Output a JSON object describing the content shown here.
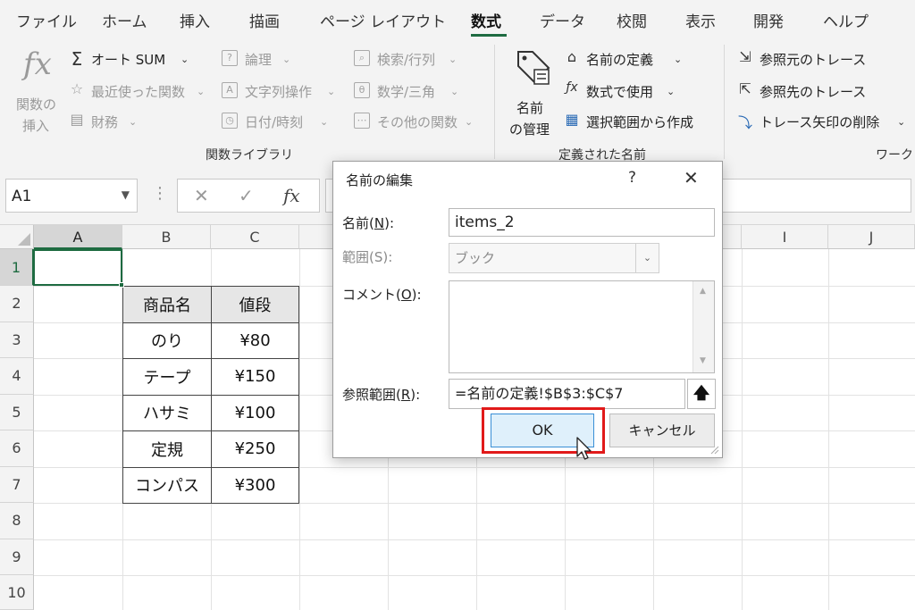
{
  "ribbon_tabs": [
    {
      "label": "ファイル",
      "active": false
    },
    {
      "label": "ホーム",
      "active": false
    },
    {
      "label": "挿入",
      "active": false
    },
    {
      "label": "描画",
      "active": false
    },
    {
      "label": "ページ レイアウト",
      "active": false
    },
    {
      "label": "数式",
      "active": true
    },
    {
      "label": "データ",
      "active": false
    },
    {
      "label": "校閲",
      "active": false
    },
    {
      "label": "表示",
      "active": false
    },
    {
      "label": "開発",
      "active": false
    },
    {
      "label": "ヘルプ",
      "active": false
    }
  ],
  "function_library": {
    "insert_function": {
      "icon": "fx",
      "label_line1": "関数の",
      "label_line2": "挿入"
    },
    "autosum": "オート SUM",
    "recent": "最近使った関数",
    "financial": "財務",
    "logical": "論理",
    "text": "文字列操作",
    "datetime": "日付/時刻",
    "lookup": "検索/行列",
    "math": "数学/三角",
    "more": "その他の関数",
    "group_label": "関数ライブラリ"
  },
  "defined_names": {
    "name_manager_line1": "名前",
    "name_manager_line2": "の管理",
    "define_name": "名前の定義",
    "use_in_formula": "数式で使用",
    "create_from_selection": "選択範囲から作成",
    "group_label": "定義された名前"
  },
  "formula_auditing": {
    "trace_precedents": "参照元のトレース",
    "trace_dependents": "参照先のトレース",
    "remove_arrows": "トレース矢印の削除",
    "group_label": "ワーク"
  },
  "formula_bar": {
    "name_box": "A1",
    "cancel_icon": "✕",
    "enter_icon": "✓",
    "fx_icon": "fx",
    "formula": ""
  },
  "grid": {
    "columns": [
      "A",
      "B",
      "C",
      "",
      "",
      "",
      "",
      "",
      "I",
      "J"
    ],
    "rows": [
      "1",
      "2",
      "3",
      "4",
      "5",
      "6",
      "7",
      "8",
      "9",
      "10"
    ],
    "selected_cell": "A1"
  },
  "table": {
    "header": [
      "商品名",
      "値段"
    ],
    "rows": [
      [
        "のり",
        "¥80"
      ],
      [
        "テープ",
        "¥150"
      ],
      [
        "ハサミ",
        "¥100"
      ],
      [
        "定規",
        "¥250"
      ],
      [
        "コンパス",
        "¥300"
      ]
    ]
  },
  "dialog": {
    "title": "名前の編集",
    "help": "?",
    "close": "✕",
    "name_label": "名前(",
    "name_key": "N",
    "name_label_end": "):",
    "name_value": "items_2",
    "scope_label": "範囲(S):",
    "scope_value": "ブック",
    "comment_label": "コメント(",
    "comment_key": "O",
    "comment_label_end": "):",
    "comment_value": "",
    "ref_label": "参照範囲(",
    "ref_key": "R",
    "ref_label_end": "):",
    "ref_value": "=名前の定義!$B$3:$C$7",
    "ok_label": "OK",
    "cancel_label": "キャンセル"
  },
  "colors": {
    "accent": "#1e6b41",
    "highlight": "#e11a1a",
    "ok_button": "#dff0fb"
  }
}
